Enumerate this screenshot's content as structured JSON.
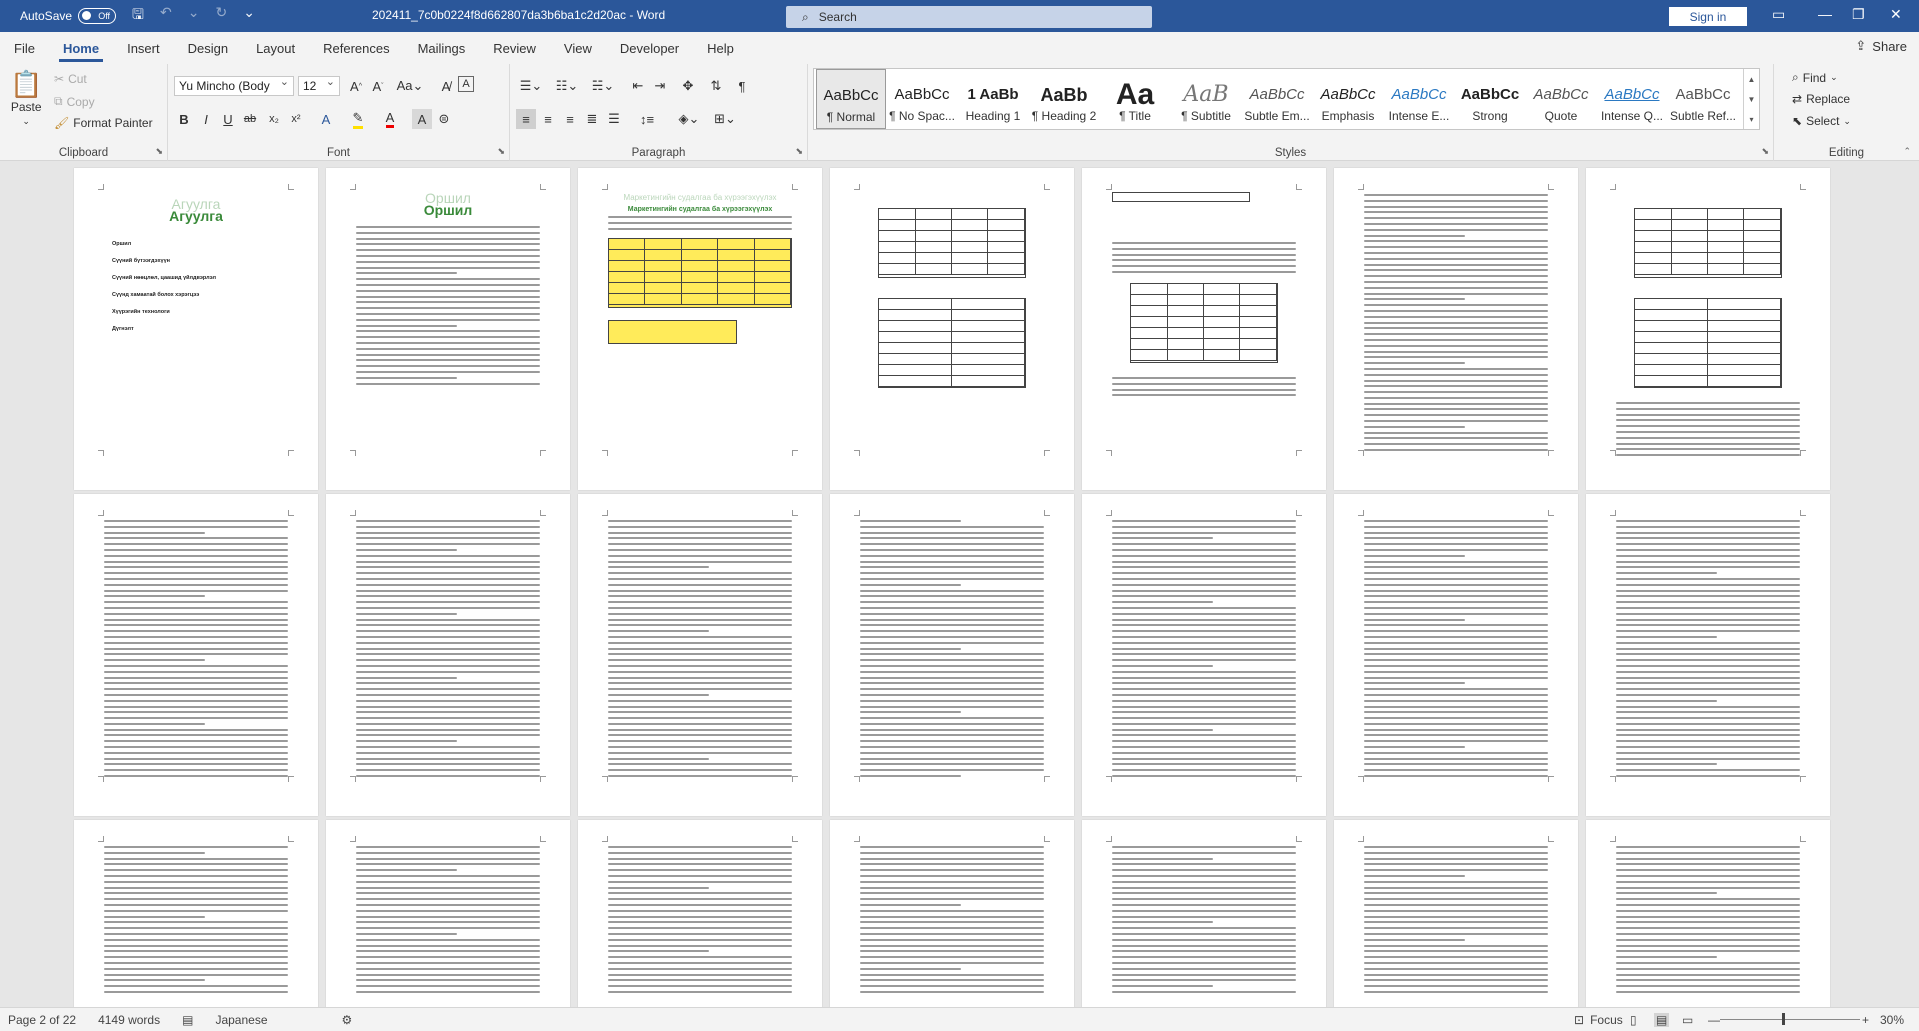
{
  "titlebar": {
    "autosave_label": "AutoSave",
    "autosave_state": "Off",
    "doc_title": "202411_7c0b0224f8d662807da3b6ba1c2d20ac  -  Word",
    "search_placeholder": "Search",
    "signin_label": "Sign in"
  },
  "tabs": [
    "File",
    "Home",
    "Insert",
    "Design",
    "Layout",
    "References",
    "Mailings",
    "Review",
    "View",
    "Developer",
    "Help"
  ],
  "share_label": "Share",
  "clipboard": {
    "paste_label": "Paste",
    "cut_label": "Cut",
    "copy_label": "Copy",
    "format_painter_label": "Format Painter",
    "group_label": "Clipboard"
  },
  "font": {
    "font_name": "Yu Mincho (Body",
    "font_size": "12",
    "group_label": "Font"
  },
  "paragraph": {
    "group_label": "Paragraph"
  },
  "styles": {
    "group_label": "Styles",
    "items": [
      {
        "sample": "AaBbCc",
        "name": "¶ Normal"
      },
      {
        "sample": "AaBbCc",
        "name": "¶ No Spac..."
      },
      {
        "sample": "1 AaBb",
        "name": "Heading 1"
      },
      {
        "sample": "AaBb",
        "name": "¶ Heading 2"
      },
      {
        "sample": "Aa",
        "name": "¶ Title"
      },
      {
        "sample": "AaB",
        "name": "¶ Subtitle"
      },
      {
        "sample": "AaBbCc",
        "name": "Subtle Em..."
      },
      {
        "sample": "AaBbCc",
        "name": "Emphasis"
      },
      {
        "sample": "AaBbCc",
        "name": "Intense E..."
      },
      {
        "sample": "AaBbCc",
        "name": "Strong"
      },
      {
        "sample": "AaBbCc",
        "name": "Quote"
      },
      {
        "sample": "AaBbCc",
        "name": "Intense Q..."
      },
      {
        "sample": "AaBbCc",
        "name": "Subtle Ref..."
      }
    ]
  },
  "editing": {
    "find_label": "Find",
    "replace_label": "Replace",
    "select_label": "Select",
    "group_label": "Editing"
  },
  "pages": {
    "p1_title": "Агуулга",
    "p1_items": [
      "Оршил",
      "Сүүний бүтээгдэхүүн",
      "Сүүний нөөцлөл, цаашид үйлдвэрлэл",
      "Сүүнд хамаатай болох хэрэгцээ",
      "Хүүрэгийн технологи",
      "Дүгнэлт"
    ],
    "p2_title": "Оршил",
    "p3_title": "Маркетингийн судалгаа ба хүрээгэхүүлэх"
  },
  "statusbar": {
    "page_info": "Page 2 of 22",
    "word_count": "4149 words",
    "language": "Japanese",
    "focus_label": "Focus",
    "zoom": "30%"
  }
}
